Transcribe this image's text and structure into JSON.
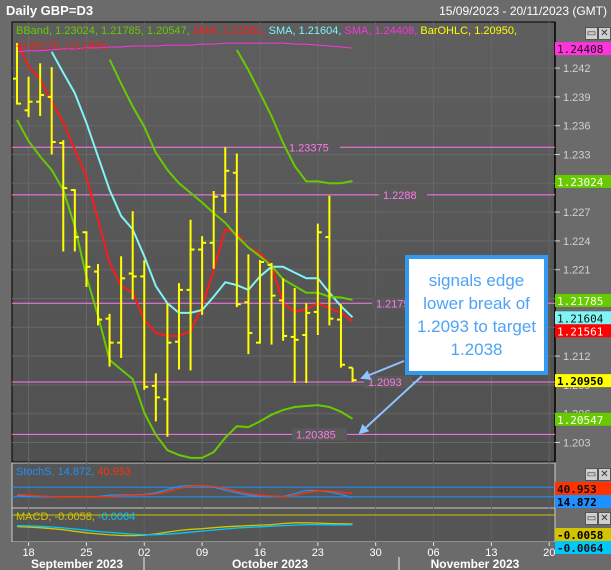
{
  "header": {
    "title": "Daily GBP=D3",
    "date_range": "15/09/2023 - 20/11/2023 (GMT)"
  },
  "legend": {
    "bband": {
      "label": "BBand,",
      "values": "1.23024, 1.21785, 1.20547,"
    },
    "sma1": {
      "label": "SMA,",
      "value": "1.21561,"
    },
    "sma2": {
      "label": "SMA,",
      "value": "1.21604,"
    },
    "sma3": {
      "label": "SMA,",
      "value": "1.24408,"
    },
    "ohlc": {
      "label": "BarOHLC,",
      "value": "1.20950,"
    },
    "change": "-0.00170, (-0.14%)"
  },
  "stoch_legend": {
    "label": "StochS,",
    "v1": "14.872,",
    "v2": "40.953"
  },
  "macd_legend": {
    "label": "MACD,",
    "v1": "-0.0058,",
    "v2": "-0.0064"
  },
  "annotation": {
    "lines": [
      "signals edge",
      "lower break of",
      "1.2093 to target",
      "1.2038"
    ]
  },
  "colors": {
    "bar": "#ffff00",
    "sma_red": "#ff1a1a",
    "sma_cyan": "#7ff5f5",
    "sma_magenta": "#ff33dd",
    "bband": "#66cc00",
    "level": "#ff77ee",
    "stoch_k": "#1e90ff",
    "stoch_d": "#ff3300",
    "macd": "#d4c400",
    "macd_signal": "#00c8ff",
    "annotation": "#3399ee"
  },
  "chart_data": {
    "type": "ohlc",
    "title": "Daily GBP=D3",
    "y_ticks": [
      "1.242",
      "1.239",
      "1.236",
      "1.233",
      "1.230",
      "1.227",
      "1.224",
      "1.221",
      "1.218",
      "1.215",
      "1.212",
      "1.209",
      "1.206",
      "1.203"
    ],
    "ylim": [
      1.2005,
      1.247
    ],
    "x_ticks": [
      "18",
      "25",
      "02",
      "09",
      "16",
      "23",
      "30",
      "06",
      "13",
      "20"
    ],
    "months": [
      "September 2023",
      "October 2023",
      "November 2023"
    ],
    "bars": [
      [
        1.2409,
        1.2446,
        1.2382,
        1.2383
      ],
      [
        1.2376,
        1.2411,
        1.2369,
        1.2385
      ],
      [
        1.2385,
        1.2425,
        1.237,
        1.2392
      ],
      [
        1.239,
        1.2421,
        1.233,
        1.2343
      ],
      [
        1.2342,
        1.2345,
        1.2229,
        1.2295
      ],
      [
        1.2293,
        1.2294,
        1.2229,
        1.2244
      ],
      [
        1.2249,
        1.225,
        1.2192,
        1.2213
      ],
      [
        1.2208,
        1.2216,
        1.2152,
        1.2158
      ],
      [
        1.2159,
        1.2164,
        1.2109,
        1.2134
      ],
      [
        1.2134,
        1.2224,
        1.2118,
        1.2201
      ],
      [
        1.2206,
        1.2271,
        1.2179,
        1.2203
      ],
      [
        1.2203,
        1.222,
        1.2085,
        1.2088
      ],
      [
        1.2089,
        1.2102,
        1.2052,
        1.2077
      ],
      [
        1.2075,
        1.2175,
        1.2036,
        1.2134
      ],
      [
        1.2135,
        1.2196,
        1.2106,
        1.2189
      ],
      [
        1.2189,
        1.2262,
        1.2105,
        1.2231
      ],
      [
        1.2231,
        1.2245,
        1.2163,
        1.2238
      ],
      [
        1.2238,
        1.2292,
        1.2211,
        1.2286
      ],
      [
        1.2287,
        1.23375,
        1.2269,
        1.2313
      ],
      [
        1.2311,
        1.2331,
        1.2171,
        1.2174
      ],
      [
        1.2176,
        1.2226,
        1.2122,
        1.2144
      ],
      [
        1.2134,
        1.222,
        1.2133,
        1.2218
      ],
      [
        1.2215,
        1.2217,
        1.2132,
        1.2183
      ],
      [
        1.2178,
        1.2201,
        1.2136,
        1.2141
      ],
      [
        1.214,
        1.2191,
        1.2092,
        1.2137
      ],
      [
        1.2142,
        1.2175,
        1.2092,
        1.2165
      ],
      [
        1.2166,
        1.2258,
        1.2142,
        1.2249
      ],
      [
        1.2244,
        1.2287,
        1.2152,
        1.2159
      ],
      [
        1.2158,
        1.2174,
        1.2108,
        1.2111
      ],
      [
        1.2108,
        1.2108,
        1.2093,
        1.2095
      ]
    ],
    "series": [
      {
        "name": "SMA red",
        "values": [
          1.2446,
          1.2422,
          1.2408,
          1.2385,
          1.2363,
          1.2335,
          1.2307,
          1.2262,
          1.2217,
          1.2193,
          1.2186,
          1.2158,
          1.2144,
          1.2141,
          1.2141,
          1.2146,
          1.2172,
          1.221,
          1.2252,
          1.2248,
          1.2233,
          1.2227,
          1.2214,
          1.2175,
          1.2166,
          1.2169,
          1.2175,
          1.217,
          1.2165,
          1.21561
        ]
      },
      {
        "name": "SMA cyan",
        "values": [
          null,
          null,
          null,
          1.2437,
          1.2415,
          1.2394,
          1.2363,
          1.2328,
          1.2293,
          1.2266,
          1.2252,
          1.2224,
          1.2193,
          1.2175,
          1.2165,
          1.2165,
          1.2168,
          1.2182,
          1.2197,
          1.2194,
          1.2189,
          1.2203,
          1.2213,
          1.2213,
          1.2207,
          1.2201,
          1.2201,
          1.2186,
          1.2172,
          1.21604
        ]
      },
      {
        "name": "SMA magenta",
        "values": [
          1.2437,
          1.2438,
          1.2438,
          1.2439,
          1.244,
          1.244,
          1.2441,
          1.2441,
          1.2442,
          1.2442,
          1.2443,
          1.2443,
          1.2443,
          1.2444,
          1.2444,
          1.2444,
          1.2445,
          1.2445,
          1.2446,
          1.2446,
          1.2446,
          1.2446,
          1.2446,
          1.2446,
          1.2445,
          1.2445,
          1.2444,
          1.2443,
          1.2442,
          1.24408
        ]
      },
      {
        "name": "BBand upper",
        "values": [
          null,
          null,
          null,
          null,
          null,
          null,
          null,
          null,
          null,
          null,
          null,
          null,
          null,
          null,
          null,
          null,
          null,
          null,
          null,
          1.2439,
          1.2418,
          1.2394,
          1.237,
          1.2342,
          1.2318,
          1.2302,
          1.2302,
          1.23,
          1.23,
          1.23024
        ]
      },
      {
        "name": "BBand middle",
        "values": [
          null,
          null,
          null,
          null,
          null,
          null,
          null,
          null,
          1.2429,
          1.2404,
          1.238,
          1.2359,
          1.2332,
          1.2314,
          1.23,
          1.229,
          1.228,
          1.2269,
          1.2259,
          1.2245,
          1.2233,
          1.2224,
          1.2214,
          1.22,
          1.2193,
          1.2186,
          1.2186,
          1.2182,
          1.2181,
          1.21785
        ]
      },
      {
        "name": "BBand lower",
        "values": [
          1.2366,
          1.2344,
          1.2328,
          1.2314,
          1.2293,
          1.2255,
          1.2203,
          1.2162,
          1.2116,
          1.2106,
          1.2096,
          1.2061,
          1.2038,
          1.2022,
          1.2017,
          1.2014,
          1.2014,
          1.202,
          1.2035,
          1.2047,
          1.2046,
          1.2052,
          1.2059,
          1.2064,
          1.2067,
          1.2068,
          1.2069,
          1.2067,
          1.2062,
          1.20547
        ]
      }
    ],
    "levels": [
      {
        "value": 1.23375,
        "label": "1.23375"
      },
      {
        "value": 1.2288,
        "label": "1.2288"
      },
      {
        "value": 1.2175,
        "label": "1.2175"
      },
      {
        "value": 1.2093,
        "label": "1.2093"
      },
      {
        "value": 1.20385,
        "label": "1.20385"
      }
    ],
    "price_badges": [
      {
        "label": "1.24408",
        "value": 1.24408,
        "bg": "#ff33dd",
        "fg": "#111"
      },
      {
        "label": "1.23024",
        "value": 1.23024,
        "bg": "#66cc00",
        "fg": "#fff"
      },
      {
        "label": "1.21785",
        "value": 1.21785,
        "bg": "#66cc00",
        "fg": "#fff"
      },
      {
        "label": "1.21604",
        "value": 1.21604,
        "bg": "#7ff5f5",
        "fg": "#111"
      },
      {
        "label": "1.21561",
        "value": 1.21561,
        "bg": "#ff0000",
        "fg": "#fff"
      },
      {
        "label": "1.20950",
        "value": 1.2095,
        "bg": "#ffff00",
        "fg": "#000"
      },
      {
        "label": "1.20547",
        "value": 1.20547,
        "bg": "#66cc00",
        "fg": "#fff"
      }
    ],
    "stochastic": {
      "k": [
        30,
        22,
        20,
        20,
        20,
        20,
        20,
        22,
        30,
        32,
        32,
        35,
        45,
        65,
        85,
        90,
        88,
        80,
        62,
        45,
        30,
        22,
        20,
        22,
        40,
        60,
        58,
        50,
        35,
        14.872
      ],
      "d": [
        35,
        30,
        25,
        22,
        20,
        20,
        20,
        20,
        22,
        26,
        30,
        32,
        38,
        52,
        72,
        86,
        90,
        85,
        72,
        55,
        40,
        30,
        25,
        22,
        28,
        45,
        58,
        56,
        48,
        40.953
      ],
      "levels": [
        80,
        20
      ],
      "badges": [
        {
          "label": "40.953",
          "bg": "#ff3300",
          "fg": "#111"
        },
        {
          "label": "14.872",
          "bg": "#1e90ff",
          "fg": "#000"
        }
      ]
    },
    "macd": {
      "macd": [
        -0.0075,
        -0.0078,
        -0.0082,
        -0.0088,
        -0.0095,
        -0.0105,
        -0.0115,
        -0.0122,
        -0.0128,
        -0.0132,
        -0.0133,
        -0.013,
        -0.0122,
        -0.011,
        -0.01,
        -0.0092,
        -0.0088,
        -0.0082,
        -0.0076,
        -0.0072,
        -0.0068,
        -0.0065,
        -0.0062,
        -0.0055,
        -0.005,
        -0.005,
        -0.0052,
        -0.0055,
        -0.0057,
        -0.0058
      ],
      "signal": [
        -0.0068,
        -0.007,
        -0.0073,
        -0.0077,
        -0.0083,
        -0.009,
        -0.0098,
        -0.0106,
        -0.0112,
        -0.0118,
        -0.0123,
        -0.0127,
        -0.0127,
        -0.0124,
        -0.0118,
        -0.0111,
        -0.0104,
        -0.0097,
        -0.009,
        -0.0084,
        -0.008,
        -0.0076,
        -0.0072,
        -0.0068,
        -0.0065,
        -0.0062,
        -0.0062,
        -0.0063,
        -0.0064,
        -0.0064
      ],
      "badges": [
        {
          "label": "-0.0058",
          "bg": "#d4c400",
          "fg": "#000"
        },
        {
          "label": "-0.0064",
          "bg": "#00c8ff",
          "fg": "#111"
        }
      ]
    }
  }
}
